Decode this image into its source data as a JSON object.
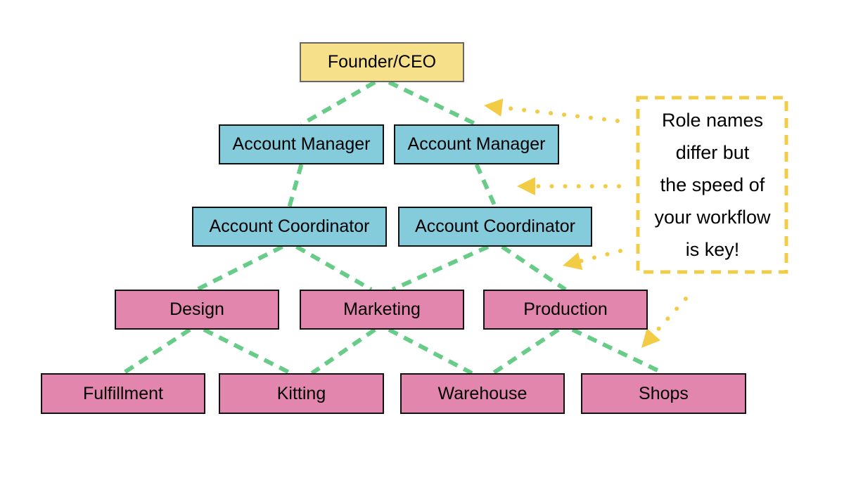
{
  "diagram": {
    "colors": {
      "root_fill": "#f7e08a",
      "manager_fill": "#84cbdb",
      "department_fill": "#e386ae",
      "connector": "#66cc88",
      "callout_accent": "#f2cc44"
    },
    "nodes": {
      "root": {
        "label": "Founder/CEO"
      },
      "account_manager_left": {
        "label": "Account Manager"
      },
      "account_manager_right": {
        "label": "Account Manager"
      },
      "account_coordinator_left": {
        "label": "Account Coordinator"
      },
      "account_coordinator_right": {
        "label": "Account Coordinator"
      },
      "design": {
        "label": "Design"
      },
      "marketing": {
        "label": "Marketing"
      },
      "production": {
        "label": "Production"
      },
      "fulfillment": {
        "label": "Fulfillment"
      },
      "kitting": {
        "label": "Kitting"
      },
      "warehouse": {
        "label": "Warehouse"
      },
      "shops": {
        "label": "Shops"
      }
    },
    "edges": [
      [
        "root",
        "account_manager_left"
      ],
      [
        "root",
        "account_manager_right"
      ],
      [
        "account_manager_left",
        "account_coordinator_left"
      ],
      [
        "account_manager_right",
        "account_coordinator_right"
      ],
      [
        "account_coordinator_left",
        "design"
      ],
      [
        "account_coordinator_left",
        "marketing"
      ],
      [
        "account_coordinator_right",
        "marketing"
      ],
      [
        "account_coordinator_right",
        "production"
      ],
      [
        "design",
        "fulfillment"
      ],
      [
        "design",
        "kitting"
      ],
      [
        "marketing",
        "kitting"
      ],
      [
        "marketing",
        "warehouse"
      ],
      [
        "production",
        "warehouse"
      ],
      [
        "production",
        "shops"
      ]
    ],
    "callout": {
      "text": "Role names\ndiffer but\nthe speed of\nyour workflow\nis key!",
      "points_to": [
        "account_manager_right",
        "account_coordinator_right",
        "production",
        "shops"
      ]
    }
  }
}
